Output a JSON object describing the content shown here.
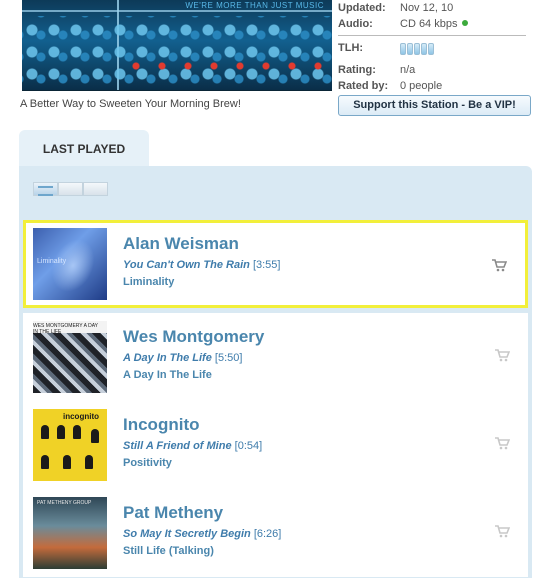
{
  "station": {
    "banner_tagline": "WE'RE MORE THAN JUST MUSIC",
    "caption": "A Better Way to Sweeten Your Morning Brew!",
    "info": {
      "updated_label": "Updated:",
      "updated_value": "Nov 12, 10",
      "audio_label": "Audio:",
      "audio_value": "CD 64 kbps",
      "tlh_label": "TLH:",
      "rating_label": "Rating:",
      "rating_value": "n/a",
      "rated_by_label": "Rated by:",
      "rated_by_value": "0 people"
    },
    "vip_button": "Support this Station - Be a VIP!"
  },
  "colors": {
    "accent": "#4a86ad",
    "highlight_border": "#f2ef3a",
    "status_green": "#3caa3c"
  },
  "tab": {
    "label": "LAST PLAYED"
  },
  "tracks": [
    {
      "artist": "Alan Weisman",
      "title": "You Can't Own The Rain",
      "duration": "[3:55]",
      "album": "Liminality",
      "art_text": "Liminality",
      "highlighted": true
    },
    {
      "artist": "Wes Montgomery",
      "title": "A Day In The Life",
      "duration": "[5:50]",
      "album": "A Day In The Life",
      "art_text": "WES MONTGOMERY A DAY IN THE LIFE",
      "highlighted": false
    },
    {
      "artist": "Incognito",
      "title": "Still A Friend of Mine",
      "duration": "[0:54]",
      "album": "Positivity",
      "art_text": "incognito",
      "highlighted": false
    },
    {
      "artist": "Pat Metheny",
      "title": "So May It Secretly Begin",
      "duration": "[6:26]",
      "album": "Still Life (Talking)",
      "art_text": "PAT METHENY GROUP",
      "highlighted": false
    }
  ],
  "icons": {
    "cart": "shopping-cart-icon",
    "status": "status-dot-icon",
    "list_view": "list-view-icon",
    "grid_view": "grid-view-icon"
  }
}
